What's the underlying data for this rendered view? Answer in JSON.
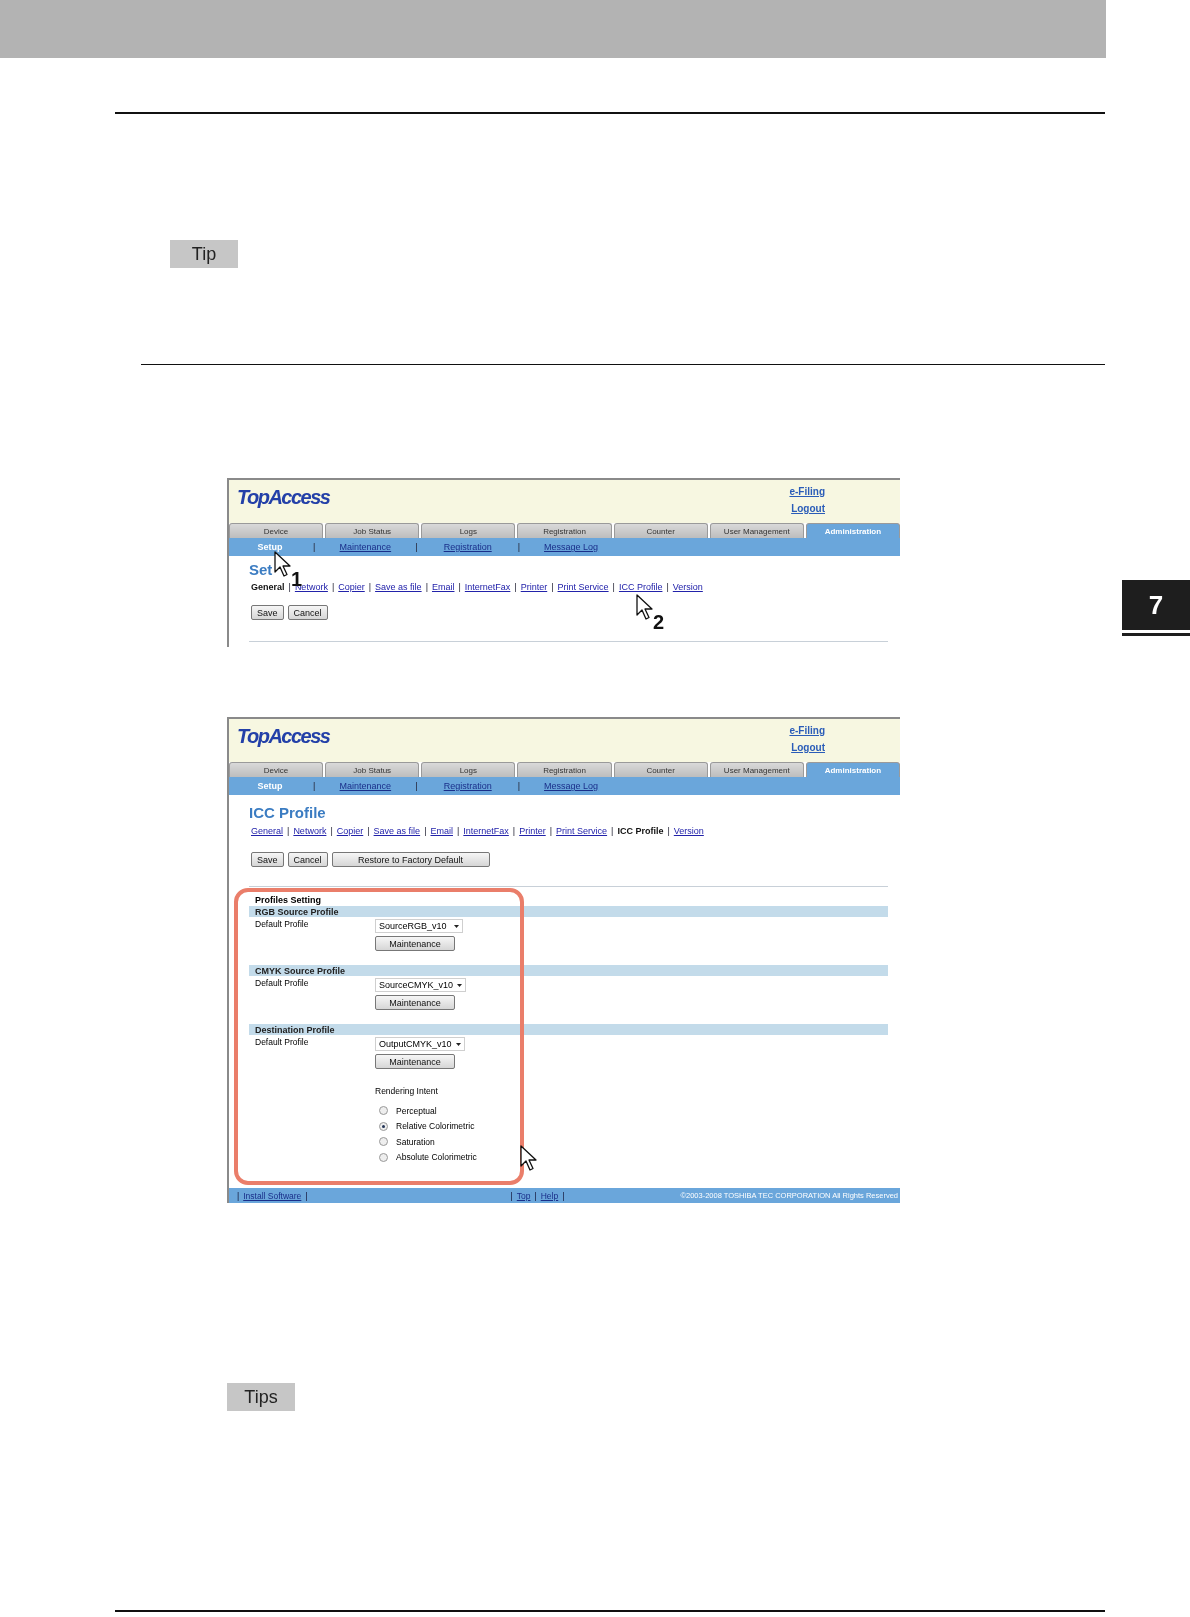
{
  "tip_labels": [
    "Tip",
    "Tips"
  ],
  "chapter_tab": "7",
  "screenshots": [
    {
      "logo": "TopAccess",
      "header_links": [
        "e-Filing",
        "Logout"
      ],
      "tabs": [
        {
          "label": "Device",
          "selected": false
        },
        {
          "label": "Job Status",
          "selected": false
        },
        {
          "label": "Logs",
          "selected": false
        },
        {
          "label": "Registration",
          "selected": false
        },
        {
          "label": "Counter",
          "selected": false
        },
        {
          "label": "User Management",
          "selected": false
        },
        {
          "label": "Administration",
          "selected": true
        }
      ],
      "subtabs": [
        {
          "label": "Setup",
          "selected": true
        },
        {
          "label": "Maintenance",
          "selected": false
        },
        {
          "label": "Registration",
          "selected": false
        },
        {
          "label": "Message Log",
          "selected": false
        }
      ],
      "separator": "|",
      "page_title": "Set",
      "links": [
        {
          "label": "General",
          "selected": true
        },
        {
          "label": "Network",
          "selected": false
        },
        {
          "label": "Copier",
          "selected": false
        },
        {
          "label": "Save as file",
          "selected": false
        },
        {
          "label": "Email",
          "selected": false
        },
        {
          "label": "InternetFax",
          "selected": false
        },
        {
          "label": "Printer",
          "selected": false
        },
        {
          "label": "Print Service",
          "selected": false
        },
        {
          "label": "ICC Profile",
          "selected": false
        },
        {
          "label": "Version",
          "selected": false
        }
      ],
      "buttons": [
        "Save",
        "Cancel"
      ],
      "cursors": [
        {
          "kind": "numbered",
          "step": "1"
        },
        {
          "kind": "numbered",
          "step": "2"
        }
      ]
    },
    {
      "logo": "TopAccess",
      "header_links": [
        "e-Filing",
        "Logout"
      ],
      "tabs": [
        {
          "label": "Device",
          "selected": false
        },
        {
          "label": "Job Status",
          "selected": false
        },
        {
          "label": "Logs",
          "selected": false
        },
        {
          "label": "Registration",
          "selected": false
        },
        {
          "label": "Counter",
          "selected": false
        },
        {
          "label": "User Management",
          "selected": false
        },
        {
          "label": "Administration",
          "selected": true
        }
      ],
      "subtabs": [
        {
          "label": "Setup",
          "selected": true
        },
        {
          "label": "Maintenance",
          "selected": false
        },
        {
          "label": "Registration",
          "selected": false
        },
        {
          "label": "Message Log",
          "selected": false
        }
      ],
      "separator": "|",
      "page_title": "ICC Profile",
      "links": [
        {
          "label": "General",
          "selected": false
        },
        {
          "label": "Network",
          "selected": false
        },
        {
          "label": "Copier",
          "selected": false
        },
        {
          "label": "Save as file",
          "selected": false
        },
        {
          "label": "Email",
          "selected": false
        },
        {
          "label": "InternetFax",
          "selected": false
        },
        {
          "label": "Printer",
          "selected": false
        },
        {
          "label": "Print Service",
          "selected": false
        },
        {
          "label": "ICC Profile",
          "selected": true
        },
        {
          "label": "Version",
          "selected": false
        }
      ],
      "buttons": [
        "Save",
        "Cancel",
        "Restore to Factory Default"
      ],
      "profiles": {
        "title": "Profiles Setting",
        "highlighted": true,
        "sections": [
          {
            "title": "RGB Source Profile",
            "field_label": "Default Profile",
            "value": "SourceRGB_v10",
            "button": "Maintenance"
          },
          {
            "title": "CMYK Source Profile",
            "field_label": "Default Profile",
            "value": "SourceCMYK_v10",
            "button": "Maintenance"
          },
          {
            "title": "Destination Profile",
            "field_label": "Default Profile",
            "value": "OutputCMYK_v10",
            "button": "Maintenance"
          }
        ],
        "rendering_intent": {
          "label": "Rendering Intent",
          "options": [
            {
              "label": "Perceptual",
              "selected": false
            },
            {
              "label": "Relative Colorimetric",
              "selected": true
            },
            {
              "label": "Saturation",
              "selected": false
            },
            {
              "label": "Absolute Colorimetric",
              "selected": false
            }
          ]
        }
      },
      "footer": {
        "left_links": [
          "Install Software"
        ],
        "center_links": [
          "Top",
          "Help"
        ],
        "copyright": "©2003-2008 TOSHIBA TEC CORPORATION All Rights Reserved"
      },
      "cursors": [
        {
          "kind": "plain"
        }
      ]
    }
  ]
}
